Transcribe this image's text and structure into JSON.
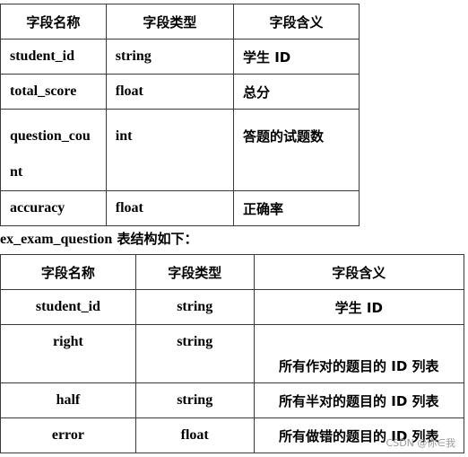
{
  "table1": {
    "headers": [
      "字段名称",
      "字段类型",
      "字段含义"
    ],
    "rows": [
      {
        "name": "student_id",
        "type": "string",
        "meaning": "学生 ID"
      },
      {
        "name": "total_score",
        "type": "float",
        "meaning": "总分"
      },
      {
        "name": "question_count",
        "type": "int",
        "meaning": "答题的试题数"
      },
      {
        "name": "accuracy",
        "type": "float",
        "meaning": "正确率"
      }
    ]
  },
  "caption": {
    "table_name": "ex_exam_question",
    "suffix": " 表结构如下："
  },
  "table2": {
    "headers": [
      "字段名称",
      "字段类型",
      "字段含义"
    ],
    "rows": [
      {
        "name": "student_id",
        "type": "string",
        "meaning": "学生 ID"
      },
      {
        "name": "right",
        "type": "string",
        "meaning": "所有作对的题目的 ID 列表"
      },
      {
        "name": "half",
        "type": "string",
        "meaning": "所有半对的题目的 ID 列表"
      },
      {
        "name": "error",
        "type": "float",
        "meaning": "所有做错的题目的 ID 列表"
      }
    ]
  },
  "watermark": "CSDN @你∈我"
}
